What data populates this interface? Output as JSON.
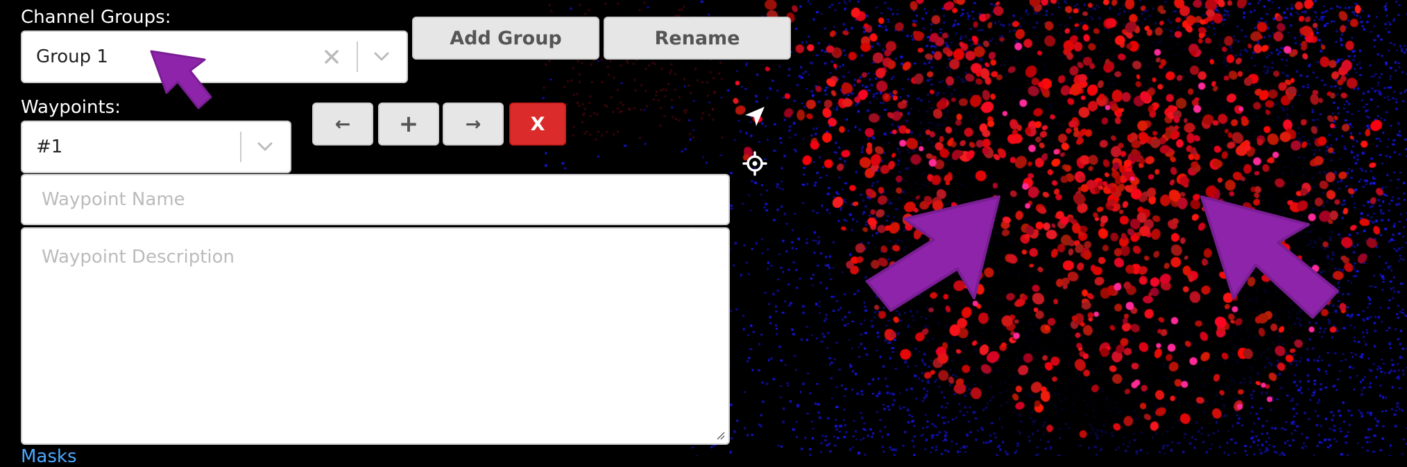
{
  "channel_groups": {
    "label": "Channel Groups:",
    "selected": "Group 1",
    "add_button": "Add Group",
    "rename_button": "Rename"
  },
  "waypoints": {
    "label": "Waypoints:",
    "selected": "#1",
    "prev_symbol": "←",
    "add_symbol": "+",
    "next_symbol": "→",
    "delete_symbol": "X",
    "name_placeholder": "Waypoint Name",
    "description_placeholder": "Waypoint Description"
  },
  "footer_link": "Masks",
  "colors": {
    "delete_button": "#dc2b2b",
    "annotation_arrow": "#8e24aa",
    "link": "#4aa8ff",
    "cells_red": "#ff1a1a",
    "cells_blue": "#1a1aff"
  },
  "icons": [
    "clear-icon",
    "chevron-down-icon",
    "arrow-left-icon",
    "plus-icon",
    "arrow-right-icon",
    "navigation-icon",
    "crosshair-icon",
    "resize-handle-icon",
    "annotation-arrow-icon"
  ]
}
